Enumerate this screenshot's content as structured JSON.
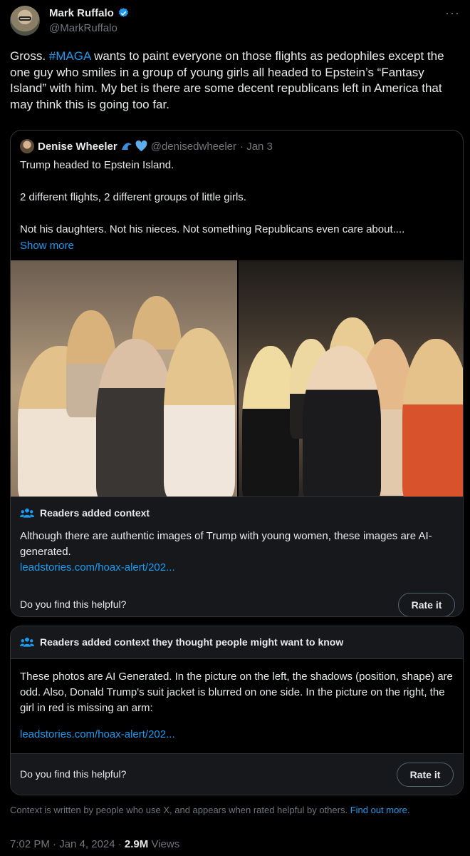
{
  "tweet": {
    "author_name": "Mark Ruffalo",
    "author_handle": "@MarkRuffalo",
    "text_before": "Gross. ",
    "hashtag": "#MAGA",
    "text_after": " wants to paint everyone on those flights as pedophiles except the one guy who smiles in a group of young girls all headed to Epstein’s “Fantasy Island” with him. My bet is there are some decent republicans left in America that may think this is going too far.",
    "more_icon": "ellipsis-icon",
    "verified_color": "#1d9bf0"
  },
  "quote": {
    "author_name": "Denise Wheeler",
    "author_handle": "@denisedwheeler",
    "date": "· Jan 3",
    "line1": "Trump headed to Epstein Island.",
    "line2": "2 different flights, 2 different groups of little girls.",
    "line3": "Not his daughters. Not his nieces. Not something Republicans even care about....",
    "show_more": "Show more",
    "context": {
      "title": "Readers added context",
      "body": "Although there are authentic images of Trump with young women, these images are AI-generated.",
      "link": "leadstories.com/hoax-alert/202...",
      "helpful_question": "Do you find this helpful?",
      "rate_label": "Rate it"
    }
  },
  "note2": {
    "title": "Readers added context they thought people might want to know",
    "body": "These photos are AI Generated. In the picture on the left, the shadows (position, shape) are odd. Also, Donald Trump's suit jacket is blurred on one side. In the picture on the right, the girl in red is missing an arm:",
    "link": "leadstories.com/hoax-alert/202...",
    "helpful_question": "Do you find this helpful?",
    "rate_label": "Rate it"
  },
  "disclaimer": {
    "text": "Context is written by people who use X, and appears when rated helpful by others.",
    "link": "Find out more."
  },
  "meta": {
    "time": "7:02 PM · Jan 4, 2024 · ",
    "views_count": "2.9M",
    "views_label": "Views"
  },
  "colors": {
    "accent": "#1d9bf0",
    "background": "#000000",
    "note_bg": "#16181c"
  }
}
